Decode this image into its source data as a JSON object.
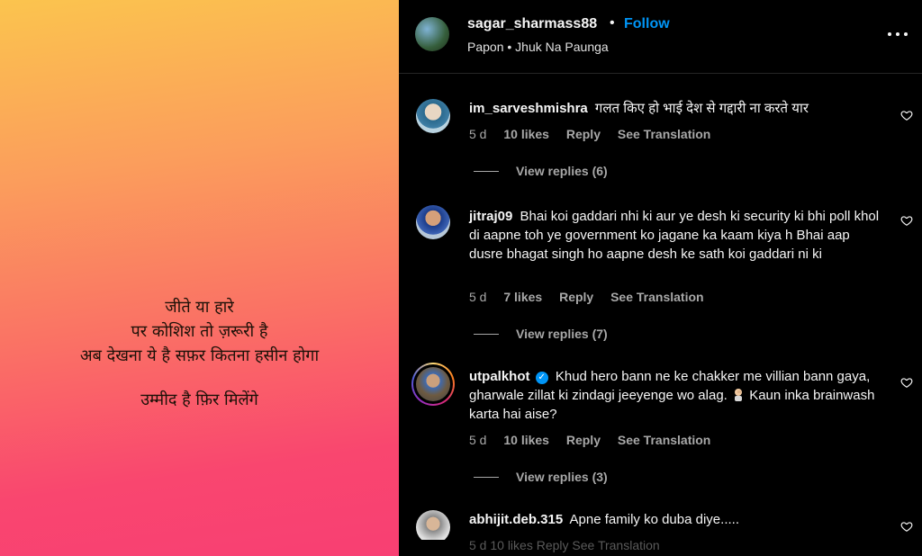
{
  "post": {
    "lines": [
      "जीते या हारे",
      "पर कोशिश तो ज़रूरी है",
      "अब देखना ये है सफ़र कितना हसीन होगा"
    ],
    "closing": "उम्मीद है फ़िर मिलेंगे",
    "gradient_colors": [
      "#fbc44e",
      "#fa7065",
      "#f83f73"
    ]
  },
  "header": {
    "username": "sagar_sharmass88",
    "separator": "•",
    "follow_label": "Follow",
    "audio": "Papon • Jhuk Na Paunga",
    "follow_color": "#0095f6"
  },
  "comments": [
    {
      "username": "im_sarveshmishra",
      "text": "गलत किए हो भाई देश से गद्दारी ना करते यार",
      "time": "5 d",
      "likes": "10 likes",
      "reply": "Reply",
      "translate": "See Translation",
      "view_replies": "View replies (6)"
    },
    {
      "username": "jitraj09",
      "text": "Bhai koi gaddari nhi ki aur ye desh ki security ki bhi poll khol di aapne toh ye government ko jagane ka kaam kiya h Bhai aap dusre bhagat singh ho aapne desh ke sath koi gaddari ni ki",
      "time": "5 d",
      "likes": "7 likes",
      "reply": "Reply",
      "translate": "See Translation",
      "view_replies": "View replies (7)"
    },
    {
      "username": "utpalkhot",
      "verified": "✓",
      "text": "Khud hero bann ne ke chakker me villian bann gaya, gharwale zillat ki zindagi jeeyenge wo alag.",
      "text_after_emoji": "Kaun inka brainwash karta hai aise?",
      "time": "5 d",
      "likes": "10 likes",
      "reply": "Reply",
      "translate": "See Translation",
      "view_replies": "View replies (3)"
    },
    {
      "username": "abhijit.deb.315",
      "text": "Apne family ko duba diye.....",
      "time": "5 d",
      "likes": "10 likes",
      "reply": "Reply",
      "translate": "See Translation"
    }
  ],
  "icons": {
    "more": "more-horizontal-icon",
    "like": "heart-outline-icon",
    "verified": "verified-badge-icon"
  }
}
